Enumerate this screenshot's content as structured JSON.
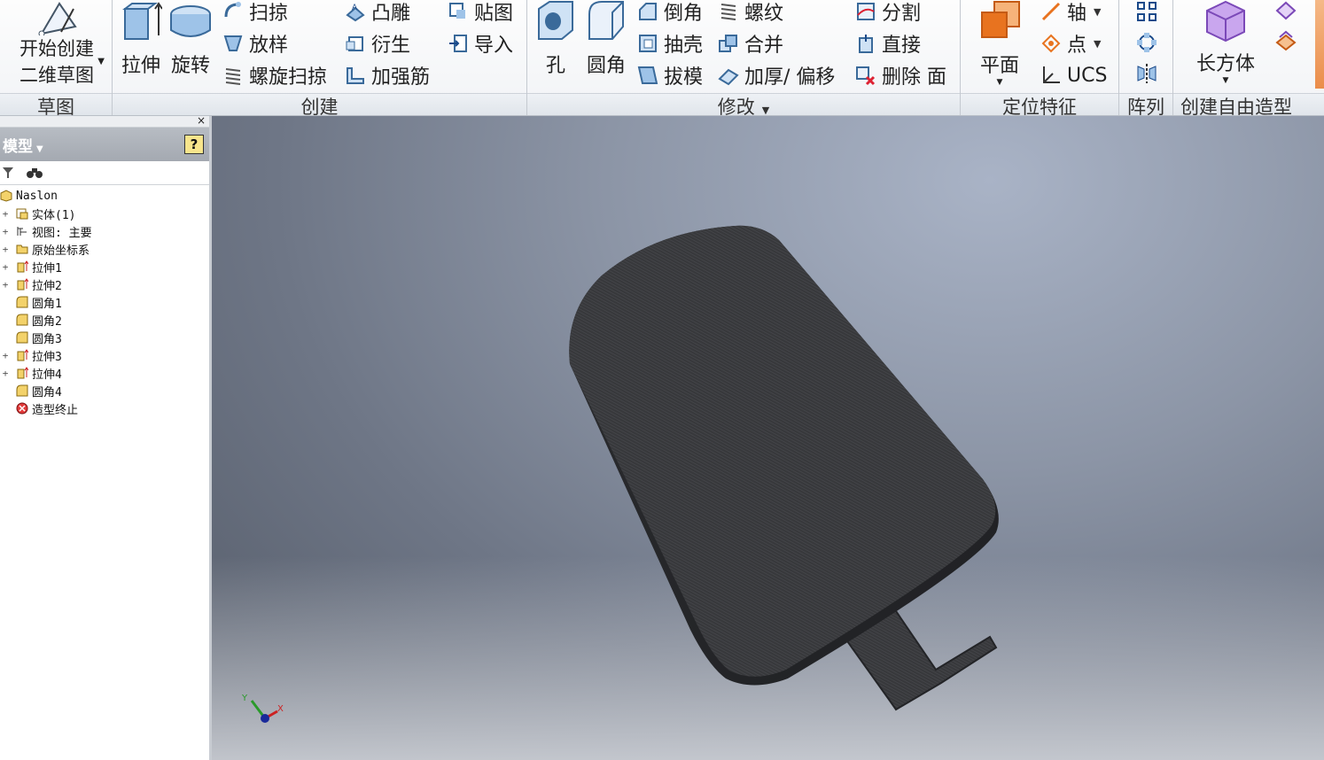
{
  "ribbon": {
    "sketch": {
      "start_sketch": "开始创建\n二维草图",
      "title": "草图"
    },
    "create": {
      "title": "创建",
      "extrude": "拉伸",
      "revolve": "旋转",
      "sweep": "扫掠",
      "loft": "放样",
      "coil": "螺旋扫掠",
      "emboss": "凸雕",
      "derive": "衍生",
      "rib": "加强筋",
      "decal": "贴图",
      "import": "导入"
    },
    "modify": {
      "title": "修改",
      "hole": "孔",
      "fillet": "圆角",
      "chamfer": "倒角",
      "shell": "抽壳",
      "draft": "拔模",
      "thread": "螺纹",
      "combine": "合并",
      "thicken": "加厚/ 偏移",
      "split": "分割",
      "direct": "直接",
      "delete_face": "删除 面"
    },
    "work_features": {
      "title": "定位特征",
      "plane": "平面",
      "axis": "轴",
      "point": "点",
      "ucs": "UCS"
    },
    "pattern": {
      "title": "阵列"
    },
    "freeform": {
      "title": "创建自由造型",
      "box": "长方体"
    }
  },
  "browser": {
    "title": "模型",
    "help": "?",
    "close": "×",
    "tree": [
      {
        "label": "Naslon",
        "icon": "part-icon",
        "expand": ""
      },
      {
        "label": "实体(1)",
        "icon": "solid-body-icon",
        "expand": "+"
      },
      {
        "label": "视图: 主要",
        "icon": "view-rep-icon",
        "expand": "+"
      },
      {
        "label": "原始坐标系",
        "icon": "folder-icon",
        "expand": "+"
      },
      {
        "label": "拉伸1",
        "icon": "extrude-feature-icon",
        "expand": "+"
      },
      {
        "label": "拉伸2",
        "icon": "extrude-feature-icon",
        "expand": "+"
      },
      {
        "label": "圆角1",
        "icon": "fillet-feature-icon",
        "expand": ""
      },
      {
        "label": "圆角2",
        "icon": "fillet-feature-icon",
        "expand": ""
      },
      {
        "label": "圆角3",
        "icon": "fillet-feature-icon",
        "expand": ""
      },
      {
        "label": "拉伸3",
        "icon": "extrude-feature-icon",
        "expand": "+"
      },
      {
        "label": "拉伸4",
        "icon": "extrude-feature-icon",
        "expand": "+"
      },
      {
        "label": "圆角4",
        "icon": "fillet-feature-icon",
        "expand": ""
      },
      {
        "label": "造型终止",
        "icon": "end-of-part-icon",
        "expand": ""
      }
    ]
  },
  "viewport": {
    "axis_x": "X",
    "axis_y": "Y"
  },
  "colors": {
    "ribbon_bg": "#f1f3f6",
    "model": "#3a3b3e",
    "accent_orange": "#e8731f"
  }
}
